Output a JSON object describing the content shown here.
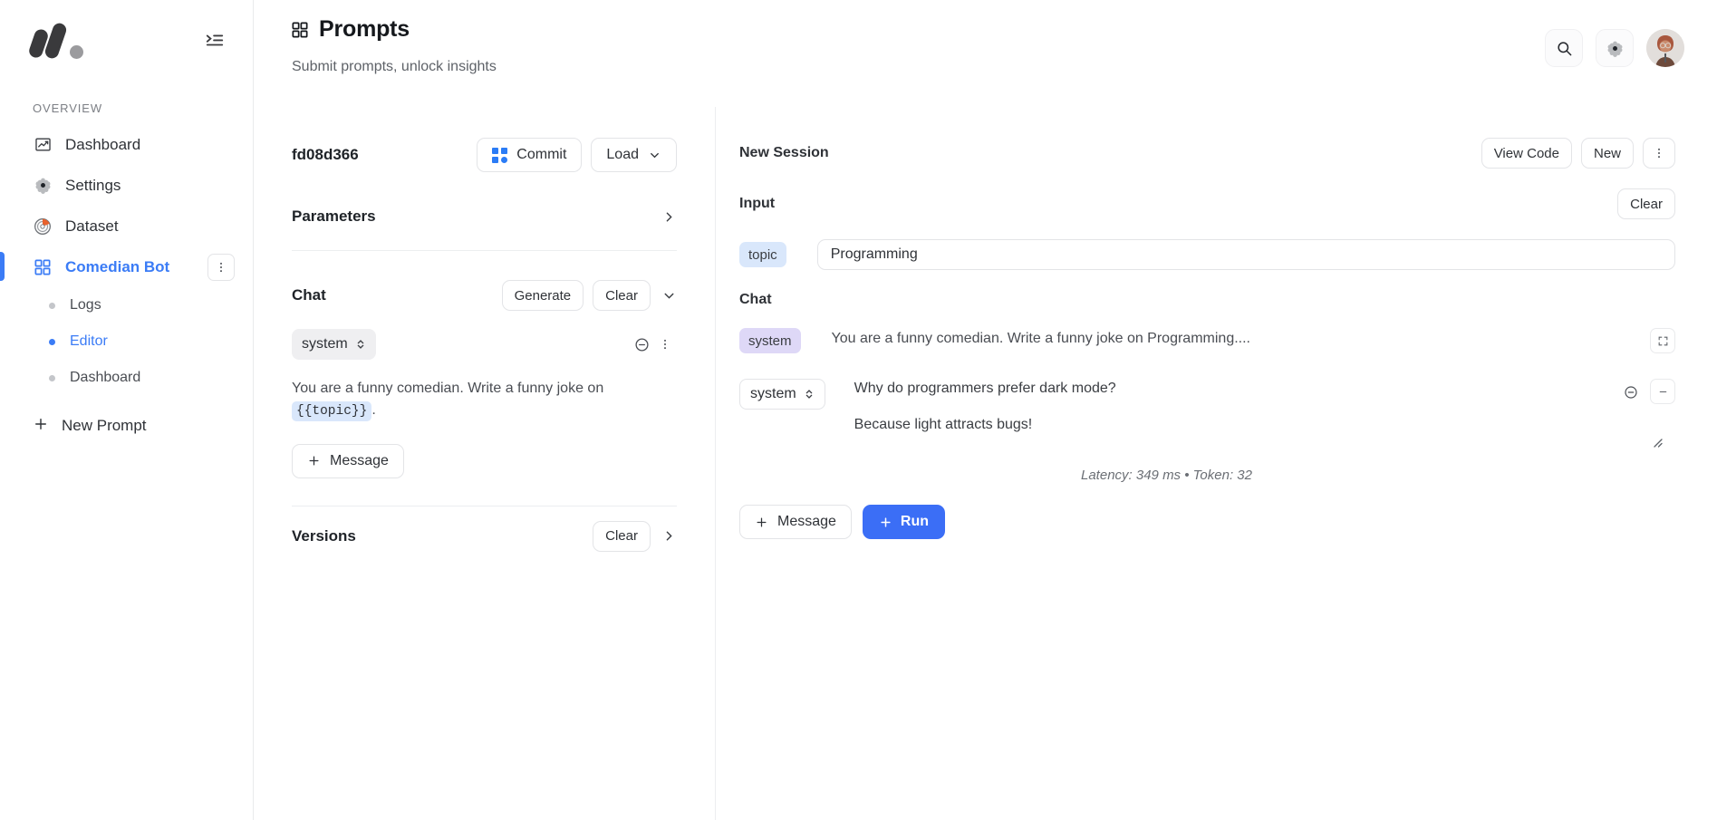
{
  "sidebar": {
    "logo_name": "app-logo",
    "collapse_icon": "collapse-sidebar-icon",
    "section_label": "OVERVIEW",
    "items": [
      {
        "label": "Dashboard",
        "icon": "chart-line-icon",
        "active": false
      },
      {
        "label": "Settings",
        "icon": "gear-icon",
        "active": false
      },
      {
        "label": "Dataset",
        "icon": "database-donut-icon",
        "active": false
      },
      {
        "label": "Comedian Bot",
        "icon": "grid-icon",
        "active": true
      }
    ],
    "subitems": [
      {
        "label": "Logs",
        "active": false
      },
      {
        "label": "Editor",
        "active": true
      },
      {
        "label": "Dashboard",
        "active": false
      }
    ],
    "new_prompt_label": "New Prompt",
    "kebab_icon": "more-vertical-icon"
  },
  "header": {
    "title": "Prompts",
    "title_icon": "grid-icon",
    "subtitle": "Submit prompts, unlock insights",
    "search_icon": "search-icon",
    "settings_icon": "gear-icon",
    "avatar_name": "user-avatar"
  },
  "left_panel": {
    "prompt_hash": "fd08d366",
    "commit_label": "Commit",
    "commit_icon": "grid-blue-icon",
    "load_label": "Load",
    "load_chevron_icon": "chevron-down-icon",
    "parameters": {
      "title": "Parameters",
      "chevron_icon": "chevron-right-icon"
    },
    "chat": {
      "title": "Chat",
      "generate_label": "Generate",
      "clear_label": "Clear",
      "chevron_icon": "chevron-down-icon",
      "message": {
        "role": "system",
        "role_stepper_icon": "chevron-up-down-icon",
        "minus_icon": "minus-circle-icon",
        "kebab_icon": "more-vertical-icon",
        "text_before": "You are a funny comedian. Write a funny joke on",
        "variable": "{{topic}}",
        "text_after": "."
      },
      "add_message_label": "Message",
      "add_message_icon": "plus-icon"
    },
    "versions": {
      "title": "Versions",
      "clear_label": "Clear",
      "chevron_icon": "chevron-right-icon"
    }
  },
  "right_panel": {
    "session_title": "New Session",
    "view_code_label": "View Code",
    "new_label": "New",
    "kebab_icon": "more-vertical-icon",
    "input": {
      "label": "Input",
      "clear_label": "Clear",
      "variable_badge": "topic",
      "value": "Programming",
      "placeholder": "Programming"
    },
    "chat": {
      "label": "Chat",
      "system_badge": "system",
      "system_text": "You are a funny comedian. Write a funny joke on Programming....",
      "expand_icon": "expand-icon",
      "response": {
        "role": "system",
        "role_stepper_icon": "chevron-up-down-icon",
        "line1": "Why do programmers prefer dark mode?",
        "line2": "Because light attracts bugs!",
        "minus_circle_icon": "minus-circle-icon",
        "collapse_icon": "minimize-icon",
        "resize_icon": "resize-handle-icon"
      },
      "meta": "Latency: 349 ms • Token: 32",
      "add_message_label": "Message",
      "add_message_icon": "plus-icon",
      "run_label": "Run",
      "run_icon": "plus-icon"
    }
  },
  "colors": {
    "accent": "#3b7cf6",
    "run_button": "#3b6ef6",
    "badge_blue": "#d9e7fb",
    "badge_purple": "#ded8f7"
  }
}
